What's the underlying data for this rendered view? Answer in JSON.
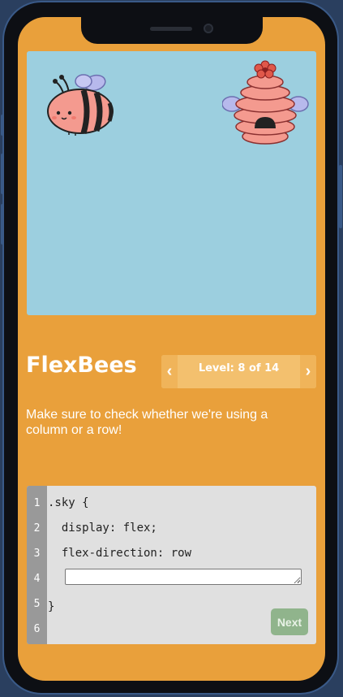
{
  "game": {
    "title": "FlexBees",
    "level_text": "Level: 8 of 14",
    "prev_arrow": "‹",
    "next_arrow": "›",
    "instructions": "Make sure to check whether we're using a column or a row!"
  },
  "editor": {
    "line_numbers": [
      "1",
      "2",
      "3",
      "4",
      "5",
      "6"
    ],
    "line1": ".sky {",
    "line2": "  display: flex;",
    "line3": "  flex-direction: row",
    "input_value": "",
    "line5": "}",
    "next_label": "Next"
  },
  "colors": {
    "background": "#e9a03b",
    "sky": "#9ccfdf",
    "editor_bg": "#e0e0e0",
    "gutter": "#999999",
    "next_button": "#90b48c"
  },
  "icons": [
    "bee-icon",
    "beehive-icon",
    "chevron-left-icon",
    "chevron-right-icon"
  ]
}
